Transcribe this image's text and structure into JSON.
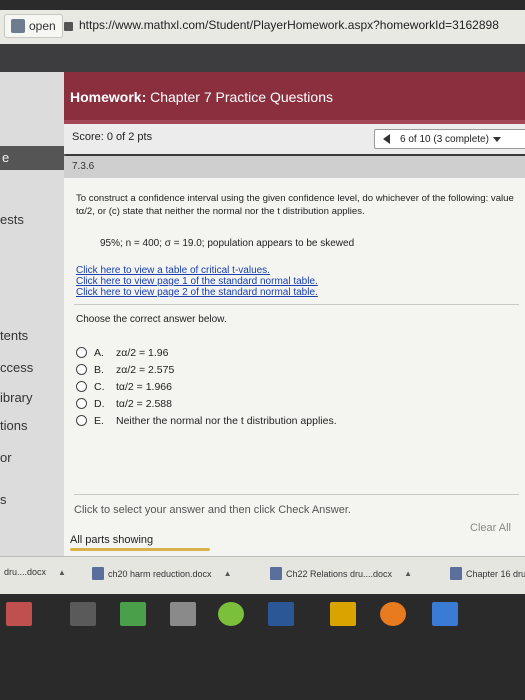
{
  "browser": {
    "tab_label": "open",
    "url": "https://www.mathxl.com/Student/PlayerHomework.aspx?homeworkId=3162898"
  },
  "sidebar": {
    "items": [
      "e",
      "ests",
      "tents",
      "ccess",
      "ibrary",
      "tions",
      "or",
      "s"
    ]
  },
  "header": {
    "homework_label": "Homework:",
    "homework_title": "Chapter 7 Practice Questions"
  },
  "score": {
    "text": "Score: 0 of 2 pts"
  },
  "progress": {
    "text": "6 of 10 (3 complete)"
  },
  "question": {
    "number": "7.3.6",
    "prompt": "To construct a confidence interval using the given confidence level, do whichever of the following: value tα/2, or (c) state that neither the normal nor the t distribution applies.",
    "given": "95%; n = 400; σ = 19.0; population appears to be skewed",
    "links": [
      "Click here to view a table of critical t-values.",
      "Click here to view page 1 of the standard normal table.",
      "Click here to view page 2 of the standard normal table."
    ],
    "instruction": "Choose the correct answer below.",
    "options": [
      {
        "letter": "A.",
        "text": "zα/2 = 1.96"
      },
      {
        "letter": "B.",
        "text": "zα/2 = 2.575"
      },
      {
        "letter": "C.",
        "text": "tα/2 = 1.966"
      },
      {
        "letter": "D.",
        "text": "tα/2 = 2.588"
      },
      {
        "letter": "E.",
        "text": "Neither the normal nor the t distribution applies."
      }
    ]
  },
  "footer": {
    "message": "Click to select your answer and then click Check Answer.",
    "clear_all": "Clear All",
    "parts_showing": "All parts showing"
  },
  "downloads": {
    "items": [
      "dru....docx",
      "ch20 harm reduction.docx",
      "Ch22 Relations dru....docx",
      "Chapter 16 dru"
    ]
  },
  "colors": {
    "header_bg": "#8b2f3f",
    "link": "#1a3fb0",
    "accent_underline": "#d9b24a"
  }
}
